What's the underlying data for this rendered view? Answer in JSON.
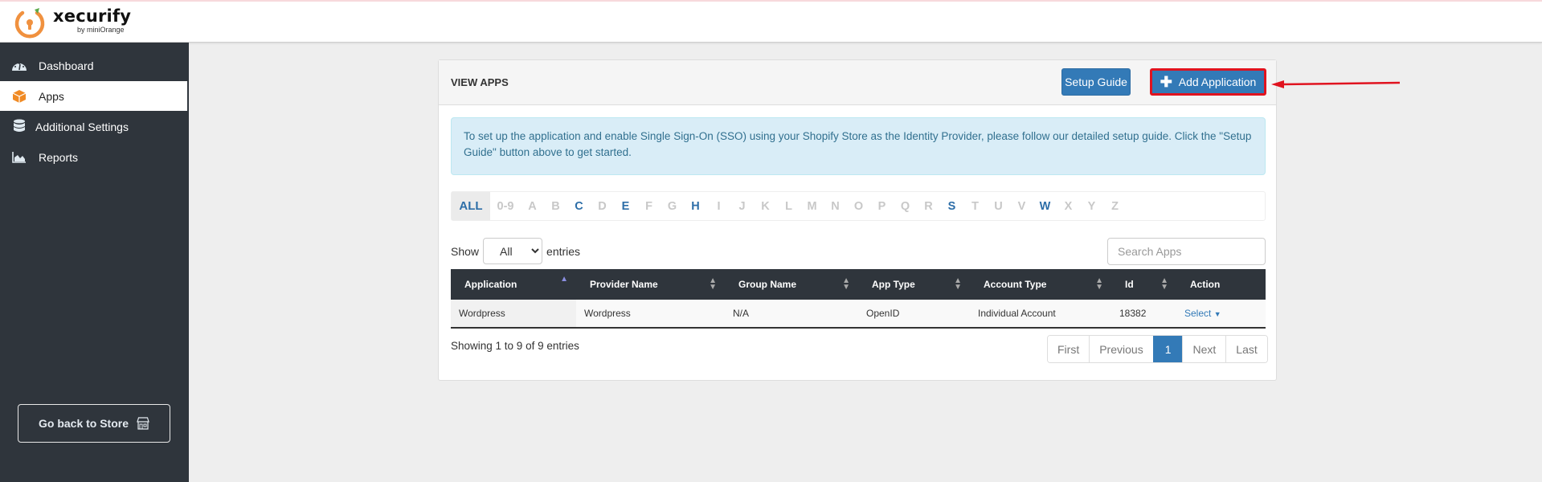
{
  "brand": {
    "name": "xecurify",
    "sub": "by miniOrange",
    "accent": "#f0913f"
  },
  "sidebar": {
    "items": [
      {
        "label": "Dashboard",
        "icon": "dashboard-icon",
        "active": false
      },
      {
        "label": "Apps",
        "icon": "cube-icon",
        "active": true
      },
      {
        "label": "Additional Settings",
        "icon": "database-icon",
        "active": false
      },
      {
        "label": "Reports",
        "icon": "area-chart-icon",
        "active": false
      }
    ],
    "store_button": "Go back to Store"
  },
  "panel": {
    "title": "VIEW APPS",
    "setup_guide_label": "Setup Guide",
    "add_application_label": "Add Application",
    "alert": "To set up the application and enable Single Sign-On (SSO) using your Shopify Store as the Identity Provider, please follow our detailed setup guide. Click the \"Setup Guide\" button above to get started."
  },
  "alphabet": {
    "items": [
      {
        "label": "ALL",
        "enabled": true,
        "active": true
      },
      {
        "label": "0-9",
        "enabled": false
      },
      {
        "label": "A",
        "enabled": false
      },
      {
        "label": "B",
        "enabled": false
      },
      {
        "label": "C",
        "enabled": true
      },
      {
        "label": "D",
        "enabled": false
      },
      {
        "label": "E",
        "enabled": true
      },
      {
        "label": "F",
        "enabled": false
      },
      {
        "label": "G",
        "enabled": false
      },
      {
        "label": "H",
        "enabled": true
      },
      {
        "label": "I",
        "enabled": false
      },
      {
        "label": "J",
        "enabled": false
      },
      {
        "label": "K",
        "enabled": false
      },
      {
        "label": "L",
        "enabled": false
      },
      {
        "label": "M",
        "enabled": false
      },
      {
        "label": "N",
        "enabled": false
      },
      {
        "label": "O",
        "enabled": false
      },
      {
        "label": "P",
        "enabled": false
      },
      {
        "label": "Q",
        "enabled": false
      },
      {
        "label": "R",
        "enabled": false
      },
      {
        "label": "S",
        "enabled": true
      },
      {
        "label": "T",
        "enabled": false
      },
      {
        "label": "U",
        "enabled": false
      },
      {
        "label": "V",
        "enabled": false
      },
      {
        "label": "W",
        "enabled": true
      },
      {
        "label": "X",
        "enabled": false
      },
      {
        "label": "Y",
        "enabled": false
      },
      {
        "label": "Z",
        "enabled": false
      }
    ]
  },
  "controls": {
    "show_label": "Show",
    "entries_label": "entries",
    "length_selected": "All",
    "search_placeholder": "Search Apps"
  },
  "table": {
    "columns": [
      "Application",
      "Provider Name",
      "Group Name",
      "App Type",
      "Account Type",
      "Id",
      "Action"
    ],
    "rows": [
      {
        "application": "Wordpress",
        "provider": "Wordpress",
        "group": "N/A",
        "app_type": "OpenID",
        "account_type": "Individual Account",
        "id": "18382",
        "action": "Select"
      }
    ]
  },
  "footer": {
    "info": "Showing 1 to 9 of 9 entries",
    "pagination": [
      "First",
      "Previous",
      "1",
      "Next",
      "Last"
    ],
    "current_page": "1"
  }
}
